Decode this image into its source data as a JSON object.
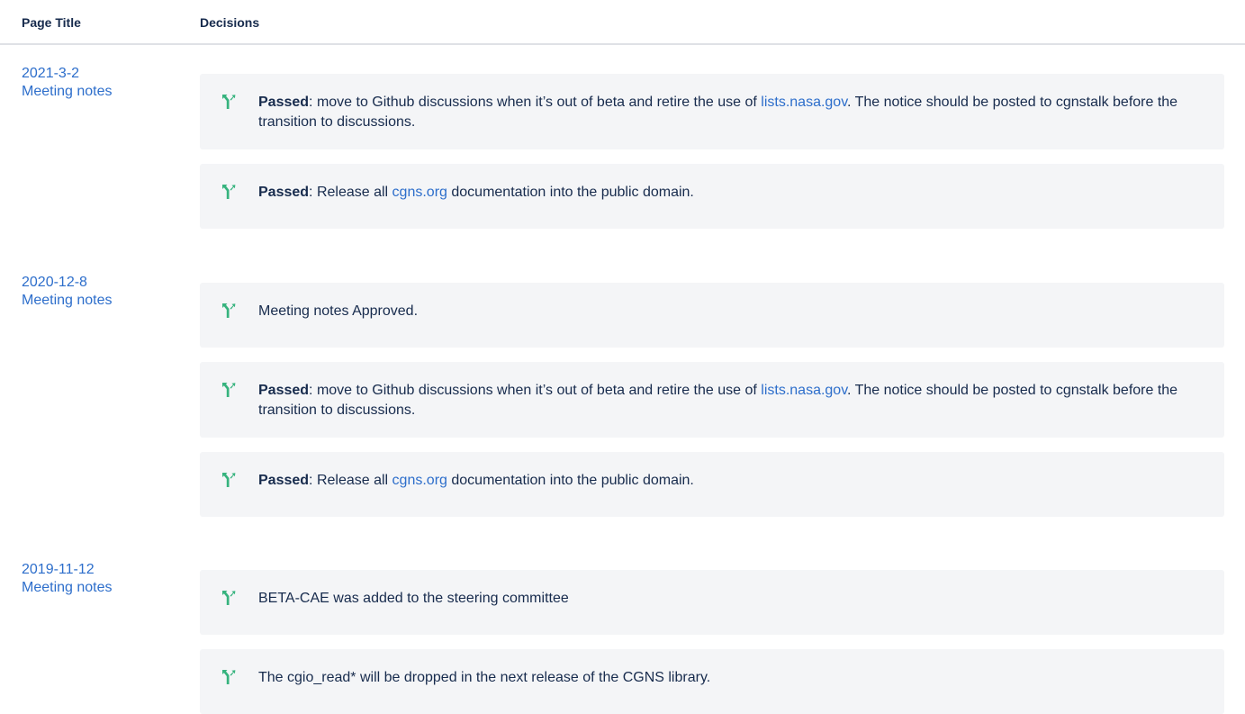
{
  "table": {
    "headers": {
      "page_title": "Page Title",
      "decisions": "Decisions"
    },
    "groups": [
      {
        "date": "2021-3-2",
        "title": "Meeting notes",
        "decisions": [
          {
            "bold": "Passed",
            "t1": ": move to Github discussions when it’s out of beta and retire the use of ",
            "link": "lists.nasa.gov",
            "t2": ". The notice should be posted to cgnstalk before the transition to discussions."
          },
          {
            "bold": "Passed",
            "t1": ": Release all ",
            "link": "cgns.org",
            "t2": " documentation into the public domain."
          }
        ]
      },
      {
        "date": "2020-12-8",
        "title": "Meeting notes",
        "decisions": [
          {
            "text": "Meeting notes Approved."
          },
          {
            "bold": "Passed",
            "t1": ": move to Github discussions when it’s out of beta and retire the use of ",
            "link": "lists.nasa.gov",
            "t2": ". The notice should be posted to cgnstalk before the transition to discussions."
          },
          {
            "bold": "Passed",
            "t1": ": Release all ",
            "link": "cgns.org",
            "t2": " documentation into the public domain."
          }
        ]
      },
      {
        "date": "2019-11-12",
        "title": "Meeting notes",
        "decisions": [
          {
            "text": "BETA-CAE was added to the steering committee"
          },
          {
            "text": "The cgio_read* will be dropped in the next release of the CGNS library."
          }
        ]
      }
    ]
  },
  "colors": {
    "link": "#2d6ecb",
    "decision_icon": "#36b37e",
    "decision_bg": "#f4f5f7",
    "text": "#172b4d"
  },
  "icons": {
    "decision": "decision-branch-icon"
  }
}
